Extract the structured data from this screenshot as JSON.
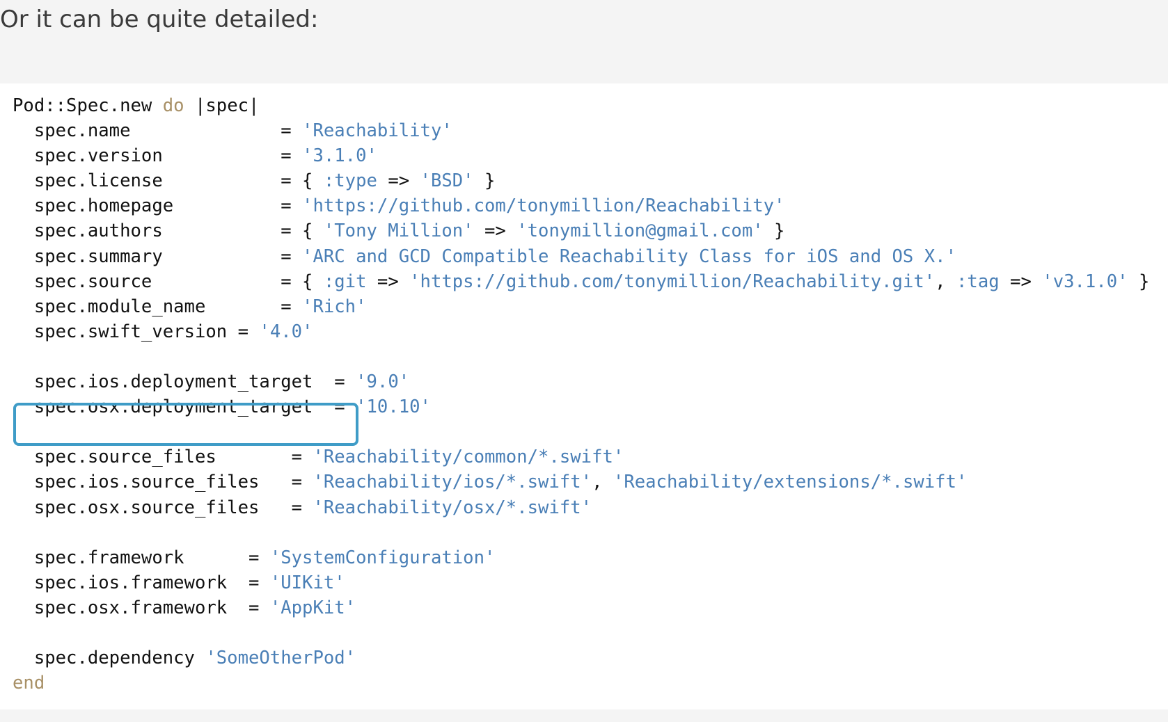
{
  "intro_text": "Or it can be quite detailed:",
  "colors": {
    "keyword": "#a89066",
    "string": "#4a7fb6",
    "highlight": "#3f9cc7"
  },
  "code_lines": [
    [
      {
        "t": "Pod::Spec.new ",
        "c": "plain"
      },
      {
        "t": "do",
        "c": "kw"
      },
      {
        "t": " |spec|",
        "c": "plain"
      }
    ],
    [
      {
        "t": "  spec.name              = ",
        "c": "plain"
      },
      {
        "t": "'Reachability'",
        "c": "str"
      }
    ],
    [
      {
        "t": "  spec.version           = ",
        "c": "plain"
      },
      {
        "t": "'3.1.0'",
        "c": "str"
      }
    ],
    [
      {
        "t": "  spec.license           = { ",
        "c": "plain"
      },
      {
        "t": ":type",
        "c": "sym"
      },
      {
        "t": " => ",
        "c": "plain"
      },
      {
        "t": "'BSD'",
        "c": "str"
      },
      {
        "t": " }",
        "c": "plain"
      }
    ],
    [
      {
        "t": "  spec.homepage          = ",
        "c": "plain"
      },
      {
        "t": "'https://github.com/tonymillion/Reachability'",
        "c": "str"
      }
    ],
    [
      {
        "t": "  spec.authors           = { ",
        "c": "plain"
      },
      {
        "t": "'Tony Million'",
        "c": "str"
      },
      {
        "t": " => ",
        "c": "plain"
      },
      {
        "t": "'tonymillion@gmail.com'",
        "c": "str"
      },
      {
        "t": " }",
        "c": "plain"
      }
    ],
    [
      {
        "t": "  spec.summary           = ",
        "c": "plain"
      },
      {
        "t": "'ARC and GCD Compatible Reachability Class for iOS and OS X.'",
        "c": "str"
      }
    ],
    [
      {
        "t": "  spec.source            = { ",
        "c": "plain"
      },
      {
        "t": ":git",
        "c": "sym"
      },
      {
        "t": " => ",
        "c": "plain"
      },
      {
        "t": "'https://github.com/tonymillion/Reachability.git'",
        "c": "str"
      },
      {
        "t": ", ",
        "c": "plain"
      },
      {
        "t": ":tag",
        "c": "sym"
      },
      {
        "t": " => ",
        "c": "plain"
      },
      {
        "t": "'v3.1.0'",
        "c": "str"
      },
      {
        "t": " }",
        "c": "plain"
      }
    ],
    [
      {
        "t": "  spec.module_name       = ",
        "c": "plain"
      },
      {
        "t": "'Rich'",
        "c": "str"
      }
    ],
    [
      {
        "t": "  spec.swift_version = ",
        "c": "plain"
      },
      {
        "t": "'4.0'",
        "c": "str"
      }
    ],
    [
      {
        "t": "",
        "c": "plain"
      }
    ],
    [
      {
        "t": "  spec.ios.deployment_target  = ",
        "c": "plain"
      },
      {
        "t": "'9.0'",
        "c": "str"
      }
    ],
    [
      {
        "t": "  spec.osx.deployment_target  = ",
        "c": "plain"
      },
      {
        "t": "'10.10'",
        "c": "str"
      }
    ],
    [
      {
        "t": "",
        "c": "plain"
      }
    ],
    [
      {
        "t": "  spec.source_files       = ",
        "c": "plain"
      },
      {
        "t": "'Reachability/common/*.swift'",
        "c": "str"
      }
    ],
    [
      {
        "t": "  spec.ios.source_files   = ",
        "c": "plain"
      },
      {
        "t": "'Reachability/ios/*.swift'",
        "c": "str"
      },
      {
        "t": ", ",
        "c": "plain"
      },
      {
        "t": "'Reachability/extensions/*.swift'",
        "c": "str"
      }
    ],
    [
      {
        "t": "  spec.osx.source_files   = ",
        "c": "plain"
      },
      {
        "t": "'Reachability/osx/*.swift'",
        "c": "str"
      }
    ],
    [
      {
        "t": "",
        "c": "plain"
      }
    ],
    [
      {
        "t": "  spec.framework      = ",
        "c": "plain"
      },
      {
        "t": "'SystemConfiguration'",
        "c": "str"
      }
    ],
    [
      {
        "t": "  spec.ios.framework  = ",
        "c": "plain"
      },
      {
        "t": "'UIKit'",
        "c": "str"
      }
    ],
    [
      {
        "t": "  spec.osx.framework  = ",
        "c": "plain"
      },
      {
        "t": "'AppKit'",
        "c": "str"
      }
    ],
    [
      {
        "t": "",
        "c": "plain"
      }
    ],
    [
      {
        "t": "  spec.dependency ",
        "c": "plain"
      },
      {
        "t": "'SomeOtherPod'",
        "c": "str"
      }
    ],
    [
      {
        "t": "end",
        "c": "kw"
      }
    ]
  ]
}
